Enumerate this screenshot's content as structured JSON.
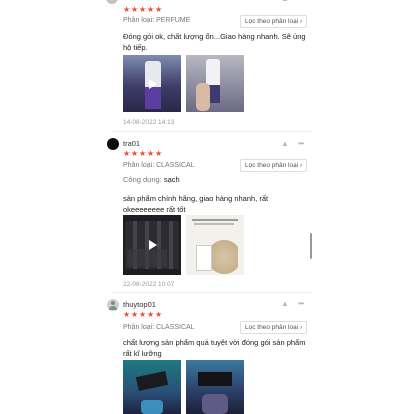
{
  "reviews": [
    {
      "username": "",
      "stars": 5,
      "variant": "Phân loại: PERFUME",
      "filter_label": "Lọc theo phân loại",
      "text_lines": [
        "Đóng gói ok, chất lượng ổn...Giao hàng nhanh. Sẽ ủng",
        "hộ tiếp."
      ],
      "timestamp": "14-08-2022 14:13"
    },
    {
      "username": "tra01",
      "stars": 5,
      "variant": "Phân loại: CLASSICAL",
      "filter_label": "Lọc theo phân loại",
      "attr_label": "Công dụng:",
      "attr_value": "sạch",
      "text_lines": [
        "sản phẩm chính hãng, giao hàng nhanh, rất",
        "okeeeeeeee rất tốt"
      ],
      "timestamp": "22-08-2022 10:07"
    },
    {
      "username": "thuytop01",
      "stars": 5,
      "variant": "Phân loại: CLASSICAL",
      "filter_label": "Lọc theo phân loại",
      "text_lines": [
        "chất lượng sản phẩm quá tuyệt vời đóng gói sản phẩm",
        "rất kĩ lưỡng"
      ]
    }
  ],
  "icons": {
    "star": "★",
    "like": "👍",
    "more": "•••",
    "chevron": "›"
  },
  "colors": {
    "star": "#ee4d2d",
    "muted": "#777777"
  }
}
